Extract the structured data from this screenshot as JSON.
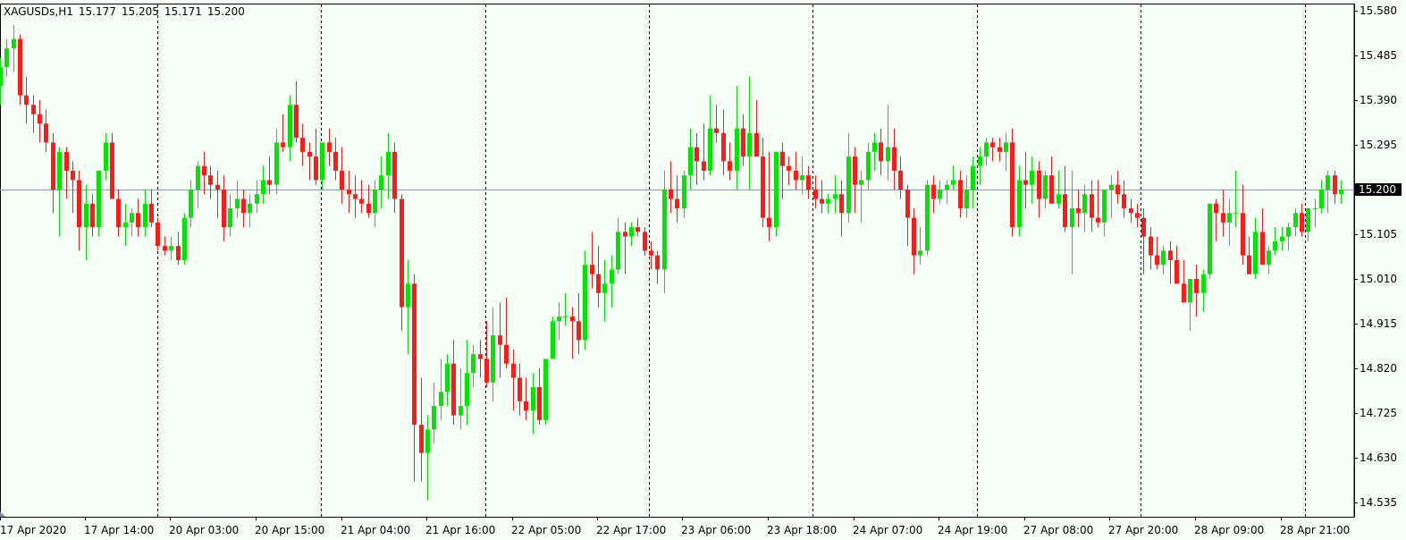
{
  "header": {
    "symbol": "XAGUSDs,H1",
    "open": "15.177",
    "high": "15.205",
    "low": "15.171",
    "close": "15.200"
  },
  "colors": {
    "background": "#F5FFF5",
    "bull": "#00E600",
    "bear": "#FF1A1A",
    "wick": "#000000",
    "price_line": "#8A9CB0",
    "grid": "#000000"
  },
  "chart_data": {
    "type": "candlestick",
    "symbol": "XAGUSDs",
    "timeframe": "H1",
    "current_price": 15.2,
    "current_price_label": "15.200",
    "ylim": [
      14.5,
      15.585
    ],
    "y_ticks": [
      "15.580",
      "15.485",
      "15.390",
      "15.295",
      "15.200",
      "15.105",
      "15.010",
      "14.915",
      "14.820",
      "14.725",
      "14.630",
      "14.535"
    ],
    "x_ticks": [
      "17 Apr 2020",
      "17 Apr 14:00",
      "20 Apr 03:00",
      "20 Apr 15:00",
      "21 Apr 04:00",
      "21 Apr 16:00",
      "22 Apr 05:00",
      "22 Apr 17:00",
      "23 Apr 06:00",
      "23 Apr 18:00",
      "24 Apr 07:00",
      "24 Apr 19:00",
      "27 Apr 08:00",
      "27 Apr 20:00",
      "28 Apr 09:00",
      "28 Apr 21:00"
    ],
    "grid": "vertical dotted separators",
    "candles": [
      [
        15.42,
        15.48,
        15.38,
        15.46
      ],
      [
        15.46,
        15.52,
        15.44,
        15.5
      ],
      [
        15.5,
        15.55,
        15.45,
        15.52
      ],
      [
        15.52,
        15.53,
        15.38,
        15.4
      ],
      [
        15.4,
        15.44,
        15.34,
        15.38
      ],
      [
        15.38,
        15.4,
        15.32,
        15.36
      ],
      [
        15.36,
        15.39,
        15.3,
        15.34
      ],
      [
        15.34,
        15.37,
        15.28,
        15.3
      ],
      [
        15.3,
        15.32,
        15.15,
        15.2
      ],
      [
        15.2,
        15.29,
        15.1,
        15.28
      ],
      [
        15.28,
        15.29,
        15.18,
        15.24
      ],
      [
        15.24,
        15.26,
        15.15,
        15.22
      ],
      [
        15.22,
        15.24,
        15.07,
        15.12
      ],
      [
        15.12,
        15.21,
        15.05,
        15.17
      ],
      [
        15.17,
        15.19,
        15.1,
        15.12
      ],
      [
        15.12,
        15.2,
        15.1,
        15.24
      ],
      [
        15.24,
        15.32,
        15.22,
        15.3
      ],
      [
        15.3,
        15.32,
        15.18,
        15.18
      ],
      [
        15.18,
        15.2,
        15.1,
        15.12
      ],
      [
        15.12,
        15.17,
        15.08,
        15.13
      ],
      [
        15.13,
        15.16,
        15.1,
        15.15
      ],
      [
        15.15,
        15.18,
        15.1,
        15.12
      ],
      [
        15.12,
        15.2,
        15.1,
        15.17
      ],
      [
        15.17,
        15.2,
        15.12,
        15.13
      ],
      [
        15.13,
        15.14,
        15.07,
        15.08
      ],
      [
        15.08,
        15.1,
        15.06,
        15.07
      ],
      [
        15.07,
        15.1,
        15.05,
        15.08
      ],
      [
        15.08,
        15.11,
        15.04,
        15.05
      ],
      [
        15.05,
        15.15,
        15.04,
        15.14
      ],
      [
        15.14,
        15.22,
        15.12,
        15.2
      ],
      [
        15.2,
        15.26,
        15.16,
        15.25
      ],
      [
        15.25,
        15.28,
        15.19,
        15.23
      ],
      [
        15.23,
        15.25,
        15.18,
        15.21
      ],
      [
        15.21,
        15.24,
        15.14,
        15.2
      ],
      [
        15.2,
        15.23,
        15.09,
        15.12
      ],
      [
        15.12,
        15.19,
        15.1,
        15.16
      ],
      [
        15.16,
        15.22,
        15.14,
        15.18
      ],
      [
        15.18,
        15.2,
        15.12,
        15.15
      ],
      [
        15.15,
        15.19,
        15.12,
        15.17
      ],
      [
        15.17,
        15.22,
        15.15,
        15.19
      ],
      [
        15.19,
        15.25,
        15.17,
        15.22
      ],
      [
        15.22,
        15.27,
        15.19,
        15.21
      ],
      [
        15.21,
        15.33,
        15.19,
        15.3
      ],
      [
        15.3,
        15.36,
        15.28,
        15.29
      ],
      [
        15.29,
        15.4,
        15.26,
        15.38
      ],
      [
        15.38,
        15.43,
        15.3,
        15.31
      ],
      [
        15.31,
        15.34,
        15.25,
        15.28
      ],
      [
        15.28,
        15.3,
        15.22,
        15.27
      ],
      [
        15.27,
        15.33,
        15.21,
        15.22
      ],
      [
        15.22,
        15.28,
        15.2,
        15.3
      ],
      [
        15.3,
        15.33,
        15.25,
        15.28
      ],
      [
        15.28,
        15.31,
        15.22,
        15.24
      ],
      [
        15.24,
        15.29,
        15.17,
        15.2
      ],
      [
        15.2,
        15.24,
        15.15,
        15.19
      ],
      [
        15.19,
        15.23,
        15.14,
        15.18
      ],
      [
        15.18,
        15.22,
        15.15,
        15.17
      ],
      [
        15.17,
        15.21,
        15.14,
        15.15
      ],
      [
        15.15,
        15.22,
        15.12,
        15.2
      ],
      [
        15.2,
        15.27,
        15.16,
        15.23
      ],
      [
        15.23,
        15.32,
        15.18,
        15.28
      ],
      [
        15.28,
        15.3,
        15.15,
        15.18
      ],
      [
        15.18,
        15.19,
        14.9,
        14.95
      ],
      [
        14.95,
        15.05,
        14.85,
        15.0
      ],
      [
        15.0,
        15.02,
        14.58,
        14.7
      ],
      [
        14.7,
        14.8,
        14.58,
        14.64
      ],
      [
        14.64,
        14.72,
        14.54,
        14.69
      ],
      [
        14.69,
        14.79,
        14.66,
        14.74
      ],
      [
        14.74,
        14.84,
        14.71,
        14.77
      ],
      [
        14.77,
        14.85,
        14.74,
        14.83
      ],
      [
        14.83,
        14.88,
        14.7,
        14.72
      ],
      [
        14.72,
        14.82,
        14.69,
        14.74
      ],
      [
        14.74,
        14.88,
        14.7,
        14.81
      ],
      [
        14.81,
        14.87,
        14.78,
        14.85
      ],
      [
        14.85,
        14.88,
        14.8,
        14.84
      ],
      [
        14.84,
        14.92,
        14.78,
        14.79
      ],
      [
        14.79,
        14.95,
        14.75,
        14.89
      ],
      [
        14.89,
        14.96,
        14.8,
        14.87
      ],
      [
        14.87,
        14.97,
        14.82,
        14.83
      ],
      [
        14.83,
        14.86,
        14.73,
        14.8
      ],
      [
        14.8,
        14.83,
        14.72,
        14.75
      ],
      [
        14.75,
        14.8,
        14.71,
        14.73
      ],
      [
        14.73,
        14.81,
        14.68,
        14.78
      ],
      [
        14.78,
        14.82,
        14.7,
        14.71
      ],
      [
        14.71,
        14.84,
        14.7,
        14.84
      ],
      [
        14.84,
        14.93,
        14.84,
        14.92
      ],
      [
        14.92,
        14.96,
        14.88,
        14.93
      ],
      [
        14.93,
        14.98,
        14.91,
        14.93
      ],
      [
        14.93,
        14.95,
        14.84,
        14.92
      ],
      [
        14.92,
        14.98,
        14.85,
        14.88
      ],
      [
        14.88,
        15.07,
        14.86,
        15.04
      ],
      [
        15.04,
        15.11,
        14.99,
        15.02
      ],
      [
        15.02,
        15.08,
        14.95,
        14.98
      ],
      [
        14.98,
        15.05,
        14.92,
        15.0
      ],
      [
        15.0,
        15.06,
        14.95,
        15.03
      ],
      [
        15.03,
        15.14,
        15.02,
        15.11
      ],
      [
        15.11,
        15.13,
        15.02,
        15.1
      ],
      [
        15.1,
        15.13,
        15.08,
        15.12
      ],
      [
        15.12,
        15.14,
        15.1,
        15.11
      ],
      [
        15.11,
        15.12,
        15.06,
        15.07
      ],
      [
        15.07,
        15.09,
        15.03,
        15.06
      ],
      [
        15.06,
        15.07,
        15.0,
        15.03
      ],
      [
        15.03,
        15.24,
        14.98,
        15.2
      ],
      [
        15.2,
        15.26,
        15.15,
        15.18
      ],
      [
        15.18,
        15.23,
        15.13,
        15.16
      ],
      [
        15.16,
        15.24,
        15.14,
        15.23
      ],
      [
        15.23,
        15.33,
        15.2,
        15.29
      ],
      [
        15.29,
        15.32,
        15.21,
        15.26
      ],
      [
        15.26,
        15.34,
        15.22,
        15.24
      ],
      [
        15.24,
        15.4,
        15.23,
        15.33
      ],
      [
        15.33,
        15.38,
        15.3,
        15.32
      ],
      [
        15.32,
        15.37,
        15.23,
        15.26
      ],
      [
        15.26,
        15.3,
        15.22,
        15.24
      ],
      [
        15.24,
        15.42,
        15.2,
        15.33
      ],
      [
        15.33,
        15.36,
        15.25,
        15.27
      ],
      [
        15.27,
        15.44,
        15.2,
        15.32
      ],
      [
        15.32,
        15.39,
        15.27,
        15.27
      ],
      [
        15.27,
        15.31,
        15.12,
        15.14
      ],
      [
        15.14,
        15.28,
        15.09,
        15.12
      ],
      [
        15.12,
        15.27,
        15.1,
        15.28
      ],
      [
        15.28,
        15.3,
        15.18,
        15.25
      ],
      [
        15.25,
        15.27,
        15.21,
        15.24
      ],
      [
        15.24,
        15.28,
        15.2,
        15.22
      ],
      [
        15.22,
        15.27,
        15.19,
        15.23
      ],
      [
        15.23,
        15.25,
        15.18,
        15.2
      ],
      [
        15.2,
        15.23,
        15.16,
        15.18
      ],
      [
        15.18,
        15.22,
        15.15,
        15.17
      ],
      [
        15.17,
        15.19,
        15.15,
        15.18
      ],
      [
        15.18,
        15.23,
        15.15,
        15.19
      ],
      [
        15.19,
        15.22,
        15.1,
        15.15
      ],
      [
        15.15,
        15.32,
        15.13,
        15.27
      ],
      [
        15.27,
        15.29,
        15.15,
        15.21
      ],
      [
        15.21,
        15.24,
        15.13,
        15.22
      ],
      [
        15.22,
        15.3,
        15.2,
        15.28
      ],
      [
        15.28,
        15.32,
        15.24,
        15.3
      ],
      [
        15.3,
        15.33,
        15.23,
        15.26
      ],
      [
        15.26,
        15.38,
        15.22,
        15.29
      ],
      [
        15.29,
        15.33,
        15.2,
        15.24
      ],
      [
        15.24,
        15.27,
        15.18,
        15.2
      ],
      [
        15.2,
        15.21,
        15.08,
        15.14
      ],
      [
        15.14,
        15.16,
        15.02,
        15.06
      ],
      [
        15.06,
        15.12,
        15.04,
        15.07
      ],
      [
        15.07,
        15.22,
        15.06,
        15.21
      ],
      [
        15.21,
        15.23,
        15.15,
        15.18
      ],
      [
        15.18,
        15.22,
        15.17,
        15.2
      ],
      [
        15.2,
        15.22,
        15.17,
        15.21
      ],
      [
        15.21,
        15.25,
        15.2,
        15.22
      ],
      [
        15.22,
        15.24,
        15.14,
        15.16
      ],
      [
        15.16,
        15.23,
        15.14,
        15.2
      ],
      [
        15.2,
        15.27,
        15.16,
        15.25
      ],
      [
        15.25,
        15.29,
        15.21,
        15.27
      ],
      [
        15.27,
        15.31,
        15.25,
        15.3
      ],
      [
        15.3,
        15.31,
        15.26,
        15.29
      ],
      [
        15.29,
        15.31,
        15.26,
        15.28
      ],
      [
        15.28,
        15.32,
        15.24,
        15.3
      ],
      [
        15.3,
        15.33,
        15.1,
        15.12
      ],
      [
        15.12,
        15.25,
        15.1,
        15.22
      ],
      [
        15.22,
        15.28,
        15.16,
        15.21
      ],
      [
        15.21,
        15.27,
        15.17,
        15.24
      ],
      [
        15.24,
        15.26,
        15.14,
        15.18
      ],
      [
        15.18,
        15.24,
        15.16,
        15.23
      ],
      [
        15.23,
        15.27,
        15.17,
        15.17
      ],
      [
        15.17,
        15.24,
        15.16,
        15.19
      ],
      [
        15.19,
        15.25,
        15.11,
        15.12
      ],
      [
        15.12,
        15.24,
        15.02,
        15.16
      ],
      [
        15.16,
        15.2,
        15.12,
        15.15
      ],
      [
        15.15,
        15.21,
        15.11,
        15.19
      ],
      [
        15.19,
        15.22,
        15.11,
        15.14
      ],
      [
        15.14,
        15.22,
        15.12,
        15.13
      ],
      [
        15.13,
        15.19,
        15.1,
        15.2
      ],
      [
        15.2,
        15.23,
        15.14,
        15.21
      ],
      [
        15.21,
        15.24,
        15.17,
        15.19
      ],
      [
        15.19,
        15.22,
        15.14,
        15.16
      ],
      [
        15.16,
        15.18,
        15.13,
        15.15
      ],
      [
        15.15,
        15.17,
        15.12,
        15.14
      ],
      [
        15.14,
        15.16,
        15.02,
        15.1
      ],
      [
        15.1,
        15.12,
        15.03,
        15.06
      ],
      [
        15.06,
        15.1,
        15.03,
        15.04
      ],
      [
        15.04,
        15.08,
        15.02,
        15.07
      ],
      [
        15.07,
        15.09,
        15.0,
        15.05
      ],
      [
        15.05,
        15.08,
        15.0,
        15.0
      ],
      [
        15.0,
        15.05,
        14.96,
        14.96
      ],
      [
        14.96,
        15.0,
        14.9,
        15.01
      ],
      [
        15.01,
        15.04,
        14.93,
        14.98
      ],
      [
        14.98,
        15.03,
        14.94,
        15.02
      ],
      [
        15.02,
        15.17,
        15.01,
        15.17
      ],
      [
        15.17,
        15.18,
        15.09,
        15.15
      ],
      [
        15.15,
        15.2,
        15.1,
        15.13
      ],
      [
        15.13,
        15.18,
        15.08,
        15.15
      ],
      [
        15.15,
        15.24,
        15.12,
        15.15
      ],
      [
        15.15,
        15.21,
        15.04,
        15.06
      ],
      [
        15.06,
        15.1,
        15.02,
        15.02
      ],
      [
        15.02,
        15.14,
        15.01,
        15.11
      ],
      [
        15.11,
        15.16,
        15.04,
        15.04
      ],
      [
        15.04,
        15.08,
        15.02,
        15.07
      ],
      [
        15.07,
        15.12,
        15.06,
        15.09
      ],
      [
        15.09,
        15.12,
        15.07,
        15.1
      ],
      [
        15.1,
        15.13,
        15.07,
        15.12
      ],
      [
        15.12,
        15.16,
        15.1,
        15.15
      ],
      [
        15.15,
        15.17,
        15.1,
        15.11
      ],
      [
        15.11,
        15.16,
        15.09,
        15.16
      ],
      [
        15.16,
        15.18,
        15.12,
        15.16
      ],
      [
        15.16,
        15.22,
        15.15,
        15.2
      ],
      [
        15.2,
        15.24,
        15.15,
        15.23
      ],
      [
        15.23,
        15.24,
        15.17,
        15.19
      ],
      [
        15.19,
        15.22,
        15.17,
        15.2
      ]
    ]
  }
}
